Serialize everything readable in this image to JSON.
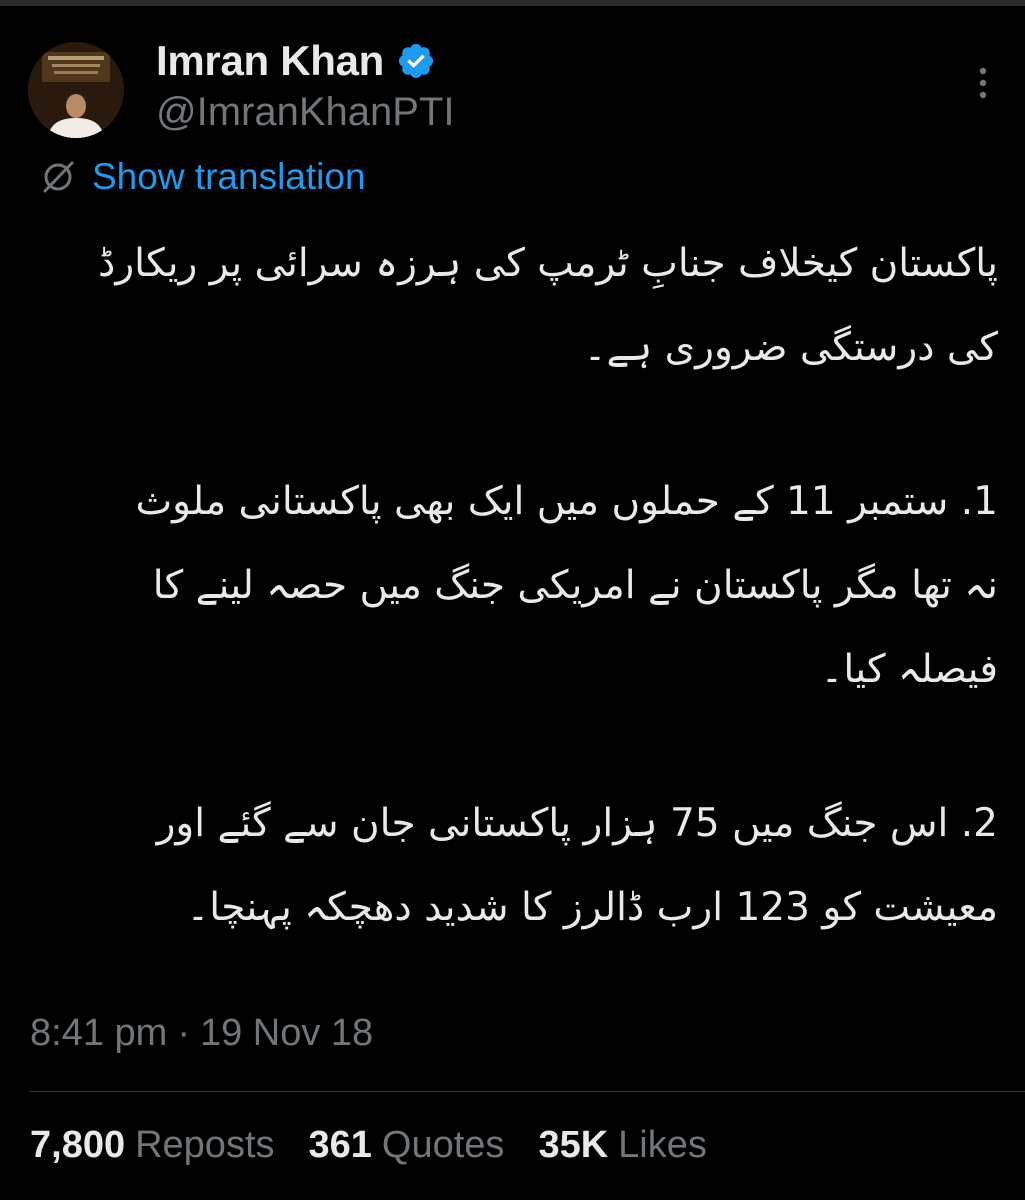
{
  "tweet": {
    "author": {
      "name": "Imran Khan",
      "handle": "@ImranKhanPTI",
      "verified": true,
      "avatar_icon": "profile-photo"
    },
    "translate_label": "Show translation",
    "body": [
      "پاکستان کیخلاف جنابِ ٹرمپ کی ہرزہ سرائی پر ریکارڈ\nکی درستگی ضروری ہے۔",
      "1. ستمبر 11 کے حملوں میں ایک بھی پاکستانی ملوث\nنہ تھا مگر پاکستان نے امریکی جنگ میں حصہ لینے کا\nفیصلہ کیا۔",
      "2. اس جنگ میں 75 ہزار پاکستانی جان سے گئے اور\nمعیشت کو 123 ارب ڈالرز کا شدید دھچکہ پہنچا۔"
    ],
    "time": "8:41 pm",
    "separator": "·",
    "date": "19 Nov 18",
    "stats": {
      "reposts_count": "7,800",
      "reposts_label": "Reposts",
      "quotes_count": "361",
      "quotes_label": "Quotes",
      "likes_count": "35K",
      "likes_label": "Likes"
    }
  },
  "colors": {
    "background": "#000000",
    "text": "#e7e9ea",
    "secondary": "#71767b",
    "link": "#1d9bf0",
    "verified": "#1d9bf0"
  }
}
